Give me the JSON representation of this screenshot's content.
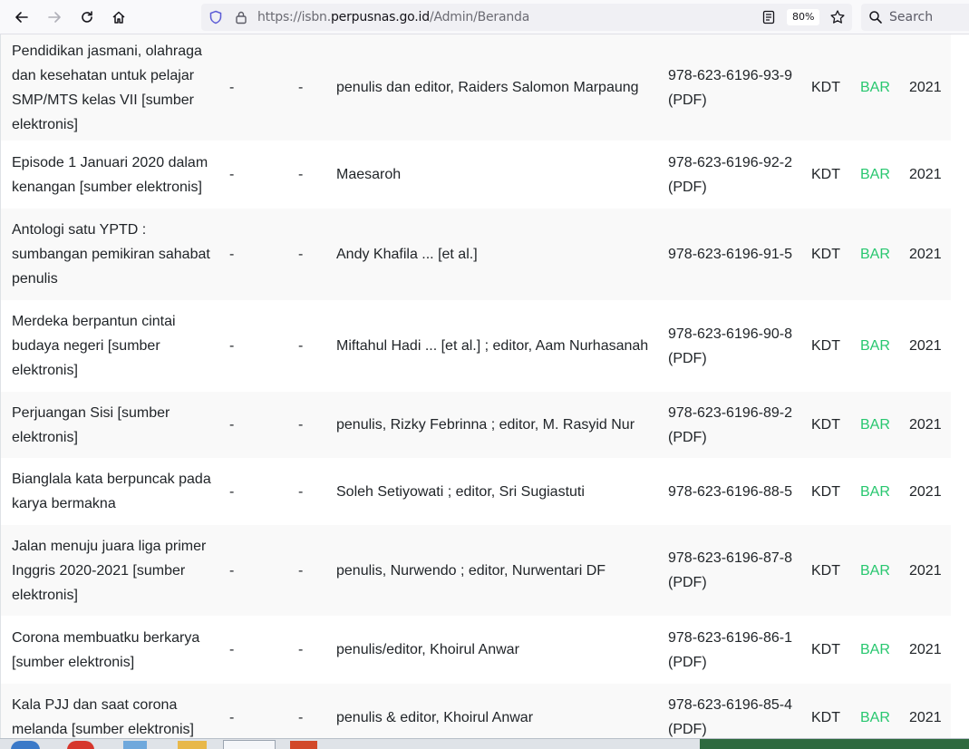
{
  "browser": {
    "url_prefix": "https://isbn.",
    "url_host": "perpusnas.go.id",
    "url_path": "/Admin/Beranda",
    "zoom": "80%",
    "search_placeholder": "Search"
  },
  "table": {
    "rows": [
      {
        "title": "Pendidikan jasmani, olahraga dan kesehatan untuk pelajar SMP/MTS kelas VII [sumber elektronis]",
        "col2": "-",
        "col3": "-",
        "author": "penulis dan editor, Raiders Salomon Marpaung",
        "isbn": "978-623-6196-93-9 (PDF)",
        "kdt": "KDT",
        "bar": "BAR",
        "year": "2021"
      },
      {
        "title": "Episode 1 Januari 2020 dalam kenangan [sumber elektronis]",
        "col2": "-",
        "col3": "-",
        "author": "Maesaroh",
        "isbn": "978-623-6196-92-2 (PDF)",
        "kdt": "KDT",
        "bar": "BAR",
        "year": "2021"
      },
      {
        "title": "Antologi satu YPTD : sumbangan pemikiran sahabat penulis",
        "col2": "-",
        "col3": "-",
        "author": "Andy Khafila ... [et al.]",
        "isbn": "978-623-6196-91-5",
        "kdt": "KDT",
        "bar": "BAR",
        "year": "2021"
      },
      {
        "title": "Merdeka berpantun cintai budaya negeri [sumber elektronis]",
        "col2": "-",
        "col3": "-",
        "author": "Miftahul Hadi ... [et al.] ; editor, Aam Nurhasanah",
        "isbn": "978-623-6196-90-8 (PDF)",
        "kdt": "KDT",
        "bar": "BAR",
        "year": "2021"
      },
      {
        "title": "Perjuangan Sisi [sumber elektronis]",
        "col2": "-",
        "col3": "-",
        "author": "penulis, Rizky Febrinna ; editor, M. Rasyid Nur",
        "isbn": "978-623-6196-89-2 (PDF)",
        "kdt": "KDT",
        "bar": "BAR",
        "year": "2021"
      },
      {
        "title": "Bianglala kata berpuncak pada karya bermakna",
        "col2": "-",
        "col3": "-",
        "author": "Soleh Setiyowati ; editor, Sri Sugiastuti",
        "isbn": "978-623-6196-88-5",
        "kdt": "KDT",
        "bar": "BAR",
        "year": "2021"
      },
      {
        "title": "Jalan menuju juara liga primer Inggris 2020-2021 [sumber elektronis]",
        "col2": "-",
        "col3": "-",
        "author": "penulis, Nurwendo ; editor, Nurwentari DF",
        "isbn": "978-623-6196-87-8 (PDF)",
        "kdt": "KDT",
        "bar": "BAR",
        "year": "2021"
      },
      {
        "title": "Corona membuatku berkarya [sumber elektronis]",
        "col2": "-",
        "col3": "-",
        "author": "penulis/editor, Khoirul Anwar",
        "isbn": "978-623-6196-86-1 (PDF)",
        "kdt": "KDT",
        "bar": "BAR",
        "year": "2021"
      },
      {
        "title": "Kala PJJ dan saat corona melanda [sumber elektronis]",
        "col2": "-",
        "col3": "-",
        "author": "penulis & editor, Khoirul Anwar",
        "isbn": "978-623-6196-85-4 (PDF)",
        "kdt": "KDT",
        "bar": "BAR",
        "year": "2021"
      }
    ]
  }
}
